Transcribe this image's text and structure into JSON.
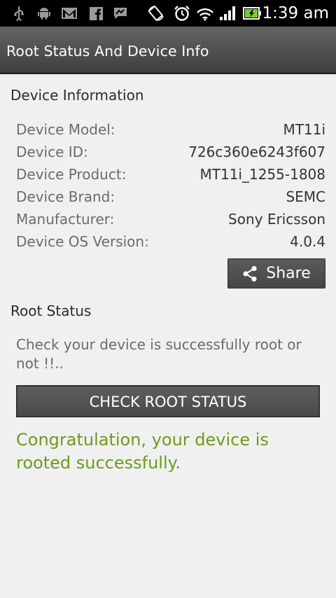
{
  "statusbar": {
    "time": "1:39 am",
    "icons": [
      "usb-icon",
      "android-icon",
      "gmail-icon",
      "facebook-icon",
      "messenger-icon",
      "rotate-icon",
      "alarm-icon",
      "wifi-icon",
      "signal-icon",
      "battery-icon"
    ],
    "battery_color": "#7ccc2a"
  },
  "actionbar": {
    "title": "Root Status And Device Info"
  },
  "device_info": {
    "heading": "Device Information",
    "rows": [
      {
        "label": "Device Model:",
        "value": "MT11i"
      },
      {
        "label": "Device ID:",
        "value": "726c360e6243f607"
      },
      {
        "label": "Device Product:",
        "value": "MT11i_1255-1808"
      },
      {
        "label": "Device Brand:",
        "value": "SEMC"
      },
      {
        "label": "Manufacturer:",
        "value": "Sony Ericsson"
      },
      {
        "label": "Device OS Version:",
        "value": "4.0.4"
      }
    ],
    "share_label": "Share"
  },
  "root_status": {
    "heading": "Root Status",
    "description": "Check your device is successfully root or not !!..",
    "check_button": "CHECK ROOT STATUS",
    "result": "Congratulation, your device is rooted successfully.",
    "result_color": "#6d9a1e"
  }
}
